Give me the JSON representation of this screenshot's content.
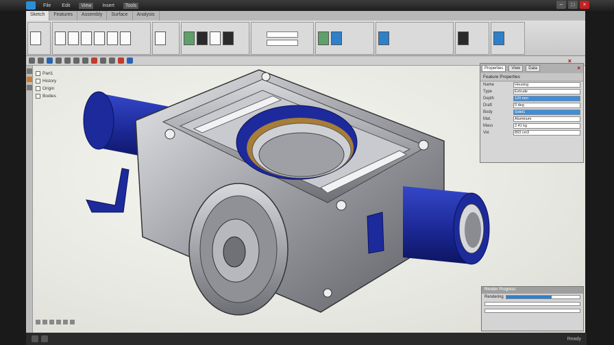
{
  "window": {
    "menu": [
      "File",
      "Edit",
      "View",
      "Insert",
      "Tools"
    ],
    "controls": [
      "minimize",
      "maximize",
      "close"
    ],
    "close_symbol": "×"
  },
  "ribbon": {
    "tabs": [
      "Sketch",
      "Features",
      "Assembly",
      "Surface",
      "Analysis"
    ],
    "active_tab": 0,
    "field_a": "",
    "field_b": ""
  },
  "tree": {
    "items": [
      "Part1",
      "History",
      "Origin",
      "Bodies"
    ]
  },
  "properties": {
    "tabs": [
      "Properties",
      "View",
      "Data"
    ],
    "title": "Feature Properties",
    "rows": [
      {
        "name": "Name",
        "value": "Housing"
      },
      {
        "name": "Type",
        "value": "Extrude"
      },
      {
        "name": "Depth",
        "value": "120 mm"
      },
      {
        "name": "Draft",
        "value": "0 deg"
      },
      {
        "name": "Body",
        "value": "Solid1"
      },
      {
        "name": "Mat.",
        "value": "Aluminum"
      },
      {
        "name": "Mass",
        "value": "2.41 kg"
      },
      {
        "name": "Vol.",
        "value": "893 cm3"
      }
    ],
    "highlighted_rows": [
      2,
      4
    ]
  },
  "dialog": {
    "title": "Render Progress",
    "progress": 0.62,
    "label": "Rendering"
  },
  "status": {
    "right_text": "Ready"
  },
  "colors": {
    "accent": "#2f7fc9",
    "model_blue": "#1c2a9c",
    "metal": "#a8aab0"
  }
}
